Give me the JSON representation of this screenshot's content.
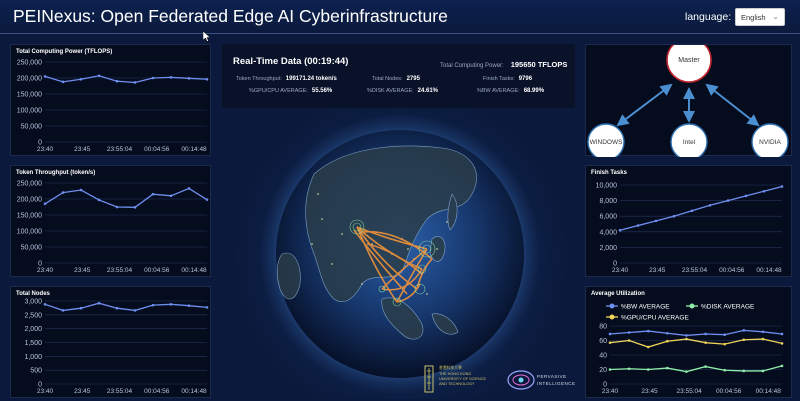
{
  "header": {
    "title": "PEINexus: Open Federated Edge AI Cyberinfrastructure",
    "language_label": "language:",
    "language_value": "English"
  },
  "left_charts": [
    {
      "title": "Total Computing Power (TFLOPS)",
      "type": "line",
      "x": [
        "23:40",
        "23:45",
        "23:55:04",
        "00:04:56",
        "00:14:48"
      ],
      "yticks": [
        "250,000",
        "200,000",
        "150,000",
        "100,000",
        "50,000",
        "0"
      ],
      "ylim": [
        0,
        250000
      ],
      "values": [
        205000,
        188000,
        196000,
        207000,
        190000,
        186000,
        200000,
        202000,
        199000,
        196000
      ]
    },
    {
      "title": "Token Throughput (token/s)",
      "type": "line",
      "x": [
        "23:40",
        "23:45",
        "23:55:04",
        "00:04:56",
        "00:14:48"
      ],
      "yticks": [
        "250,000",
        "200,000",
        "150,000",
        "100,000",
        "50,000",
        "0"
      ],
      "ylim": [
        0,
        250000
      ],
      "values": [
        185000,
        220000,
        228000,
        197000,
        175000,
        174000,
        215000,
        210000,
        233000,
        198000
      ]
    },
    {
      "title": "Total Nodes",
      "type": "line",
      "x": [
        "23:40",
        "23:45",
        "23:55:04",
        "00:04:56",
        "00:14:48"
      ],
      "yticks": [
        "3,000",
        "2,500",
        "2,000",
        "1,500",
        "1,000",
        "500",
        "0"
      ],
      "ylim": [
        0,
        3000
      ],
      "values": [
        2880,
        2660,
        2740,
        2920,
        2740,
        2660,
        2850,
        2880,
        2830,
        2770
      ]
    }
  ],
  "realtime": {
    "title": "Real-Time Data  (00:19:44)",
    "total_computing_power_label": "Total Computing Power:",
    "total_computing_power_value": "195650 TFLOPS",
    "token_throughput_label": "Token Throughput:",
    "token_throughput_value": "199171.24 token/s",
    "total_nodes_label": "Total Nodes:",
    "total_nodes_value": "2795",
    "finish_tasks_label": "Finish Tasks:",
    "finish_tasks_value": "9796",
    "gpu_label": "%GPU/CPU AVERAGE:",
    "gpu_value": "55.56%",
    "disk_label": "%DISK AVERAGE:",
    "disk_value": "24.61%",
    "bw_label": "%BW AVERAGE:",
    "bw_value": "68.99%"
  },
  "topology": {
    "master": "Master",
    "nodes": [
      "WINDOWS",
      "Intel",
      "NVIDIA"
    ]
  },
  "right_charts": [
    {
      "title": "Finish Tasks",
      "type": "line",
      "x": [
        "23:40",
        "23:45",
        "23:55:04",
        "00:04:56",
        "00:14:48"
      ],
      "yticks": [
        "10,000",
        "8,000",
        "6,000",
        "4,000",
        "2,000",
        "0"
      ],
      "ylim": [
        0,
        10000
      ],
      "values": [
        4200,
        4800,
        5400,
        6000,
        6700,
        7400,
        8000,
        8600,
        9200,
        9800
      ]
    },
    {
      "title": "Average Utilization",
      "type": "line",
      "x": [
        "23:40",
        "23:45",
        "23:55:04",
        "00:04:56",
        "00:14:48"
      ],
      "yticks": [
        "80",
        "60",
        "40",
        "20",
        "0"
      ],
      "ylim": [
        0,
        80
      ],
      "legend": [
        "%BW AVERAGE",
        "%DISK AVERAGE",
        "%GPU/CPU AVERAGE"
      ],
      "colors": [
        "#6f8ff0",
        "#8ef0a8",
        "#f0d35a"
      ],
      "series": [
        {
          "name": "%BW AVERAGE",
          "values": [
            69,
            71,
            73,
            70,
            67,
            69,
            68,
            74,
            72,
            69
          ]
        },
        {
          "name": "%DISK AVERAGE",
          "values": [
            20,
            21,
            20,
            22,
            17,
            24,
            19,
            18,
            18,
            25
          ]
        },
        {
          "name": "%GPU/CPU AVERAGE",
          "values": [
            57,
            60,
            51,
            59,
            62,
            57,
            55,
            61,
            62,
            56
          ]
        }
      ]
    }
  ],
  "logos": {
    "university_line1": "香港科技大學",
    "university_line2": "THE HONG KONG",
    "university_line3": "UNIVERSITY OF SCIENCE",
    "university_line4": "AND TECHNOLOGY",
    "lab_line1": "PERVASIVE",
    "lab_line2": "INTELLIGENCE"
  },
  "colors": {
    "line": "#6f8ff0",
    "background": "#0b1a3c",
    "panel": "#050c1e",
    "arc": "#f0933a"
  }
}
